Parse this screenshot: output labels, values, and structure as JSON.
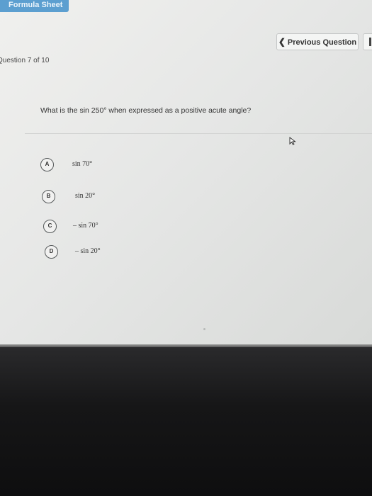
{
  "header": {
    "formula_sheet_label": "Formula Sheet",
    "previous_question_label": "Previous Question"
  },
  "question": {
    "counter": "Question 7 of 10",
    "text": "What is the sin 250° when expressed as a positive acute angle?"
  },
  "options": [
    {
      "letter": "A",
      "label": "sin 70°"
    },
    {
      "letter": "B",
      "label": "sin 20°"
    },
    {
      "letter": "C",
      "label": "– sin 70°"
    },
    {
      "letter": "D",
      "label": "– sin 20°"
    }
  ],
  "icons": {
    "previous": "chevron-left-icon",
    "cursor": "mouse-pointer-icon"
  },
  "colors": {
    "accent": "#5c9fd0",
    "background": "#e9eae9",
    "bezel": "#161617"
  }
}
